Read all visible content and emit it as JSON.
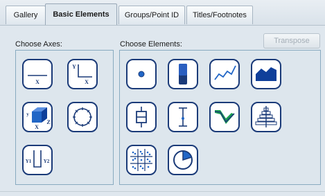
{
  "tabs": [
    {
      "label": "Gallery",
      "active": false
    },
    {
      "label": "Basic Elements",
      "active": true
    },
    {
      "label": "Groups/Point ID",
      "active": false
    },
    {
      "label": "Titles/Footnotes",
      "active": false
    }
  ],
  "axes_panel": {
    "label": "Choose Axes:",
    "buttons": [
      {
        "icon": "x-axis-icon",
        "x_label": "X"
      },
      {
        "icon": "xy-axes-icon",
        "x_label": "X",
        "y_label": "Y"
      },
      {
        "icon": "3d-axes-icon",
        "x_label": "X",
        "y_label": "y",
        "z_label": "Z"
      },
      {
        "icon": "polar-axis-icon"
      },
      {
        "icon": "dual-y-axes-icon",
        "y1_label": "Y1",
        "y2_label": "Y2"
      }
    ]
  },
  "elements_panel": {
    "label": "Choose Elements:",
    "transpose_label": "Transpose",
    "buttons": [
      {
        "icon": "point-icon"
      },
      {
        "icon": "bar-icon"
      },
      {
        "icon": "line-icon"
      },
      {
        "icon": "area-icon"
      },
      {
        "icon": "boxplot-icon"
      },
      {
        "icon": "error-bar-icon"
      },
      {
        "icon": "ribbon-icon"
      },
      {
        "icon": "population-pyramid-icon"
      },
      {
        "icon": "dot-plot-icon"
      },
      {
        "icon": "pie-icon"
      }
    ]
  },
  "colors": {
    "icon_blue": "#1a3a78",
    "fill_blue": "#2166c6",
    "ribbon_green": "#1aa150",
    "background": "#dfe7ee"
  }
}
